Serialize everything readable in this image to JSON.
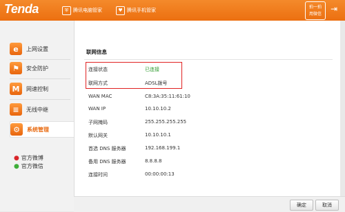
{
  "header": {
    "logo": "Tenda",
    "badges": [
      {
        "label": "腾讯电脑管家",
        "icon": "shield-icon"
      },
      {
        "label": "腾讯手机管家",
        "icon": "heart-shield-icon"
      }
    ],
    "app_button": [
      "拍一拍",
      "用微信"
    ],
    "colors": {
      "brand": "#ec6f10"
    }
  },
  "sidebar": {
    "items": [
      {
        "label": "上网设置",
        "icon": "internet-explorer-icon"
      },
      {
        "label": "安全防护",
        "icon": "shield-icon"
      },
      {
        "label": "网速控制",
        "icon": "bandwidth-icon"
      },
      {
        "label": "无线中继",
        "icon": "wireless-icon"
      },
      {
        "label": "系统管理",
        "icon": "system-gear-icon"
      }
    ],
    "social": [
      {
        "label": "官方微博",
        "icon": "weibo-icon"
      },
      {
        "label": "官方微信",
        "icon": "wechat-icon"
      }
    ]
  },
  "main": {
    "section_title": "联网信息",
    "rows": [
      {
        "label": "连接状态",
        "value": "已连接"
      },
      {
        "label": "联网方式",
        "value": "ADSL拨号"
      },
      {
        "label": "WAN MAC",
        "value": "C8:3A:35:11:61:10"
      },
      {
        "label": "WAN IP",
        "value": "10.10.10.2"
      },
      {
        "label": "子网掩码",
        "value": "255.255.255.255"
      },
      {
        "label": "默认网关",
        "value": "10.10.10.1"
      },
      {
        "label": "首选 DNS 服务器",
        "value": "192.168.199.1"
      },
      {
        "label": "备用 DNS 服务器",
        "value": "8.8.8.8"
      },
      {
        "label": "连接时间",
        "value": "00:00:00:13"
      }
    ]
  },
  "footer": {
    "ok_label": "确定",
    "cancel_label": "取消"
  }
}
